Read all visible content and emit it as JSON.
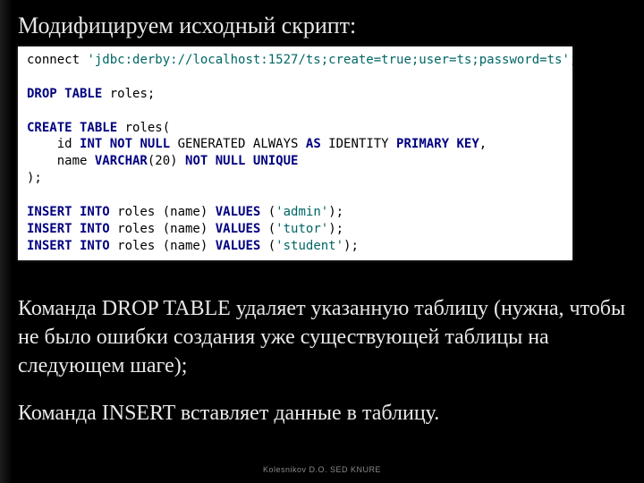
{
  "heading": "Модифицируем исходный скрипт:",
  "code": {
    "line1": {
      "t1": "connect ",
      "s1": "'jdbc:derby://localhost:1527/ts;create=true;user=ts;password=ts'",
      "t2": ";"
    },
    "line3": {
      "kw": "DROP TABLE",
      "t": " roles;"
    },
    "line5": {
      "kw": "CREATE TABLE",
      "t": " roles("
    },
    "line6": {
      "t1": "    id ",
      "kw1": "INT NOT NULL",
      "t2": " GENERATED ALWAYS ",
      "kw2": "AS",
      "t3": " IDENTITY ",
      "kw3": "PRIMARY KEY",
      "t4": ","
    },
    "line7": {
      "t1": "    name ",
      "kw1": "VARCHAR",
      "t2": "(20) ",
      "kw2": "NOT NULL UNIQUE"
    },
    "line8": {
      "t": ");"
    },
    "line10": {
      "kw1": "INSERT INTO",
      "t1": " roles (name) ",
      "kw2": "VALUES",
      "t2": " (",
      "s": "'admin'",
      "t3": ");"
    },
    "line11": {
      "kw1": "INSERT INTO",
      "t1": " roles (name) ",
      "kw2": "VALUES",
      "t2": " (",
      "s": "'tutor'",
      "t3": ");"
    },
    "line12": {
      "kw1": "INSERT INTO",
      "t1": " roles (name) ",
      "kw2": "VALUES",
      "t2": " (",
      "s": "'student'",
      "t3": ");"
    }
  },
  "paragraph1": "Команда DROP TABLE удаляет указанную таблицу (нужна, чтобы не было ошибки создания уже существующей таблицы на следующем шаге);",
  "paragraph2": "Команда INSERT вставляет данные в таблицу.",
  "footer": "Kolesnikov D.O. SED KNURE"
}
